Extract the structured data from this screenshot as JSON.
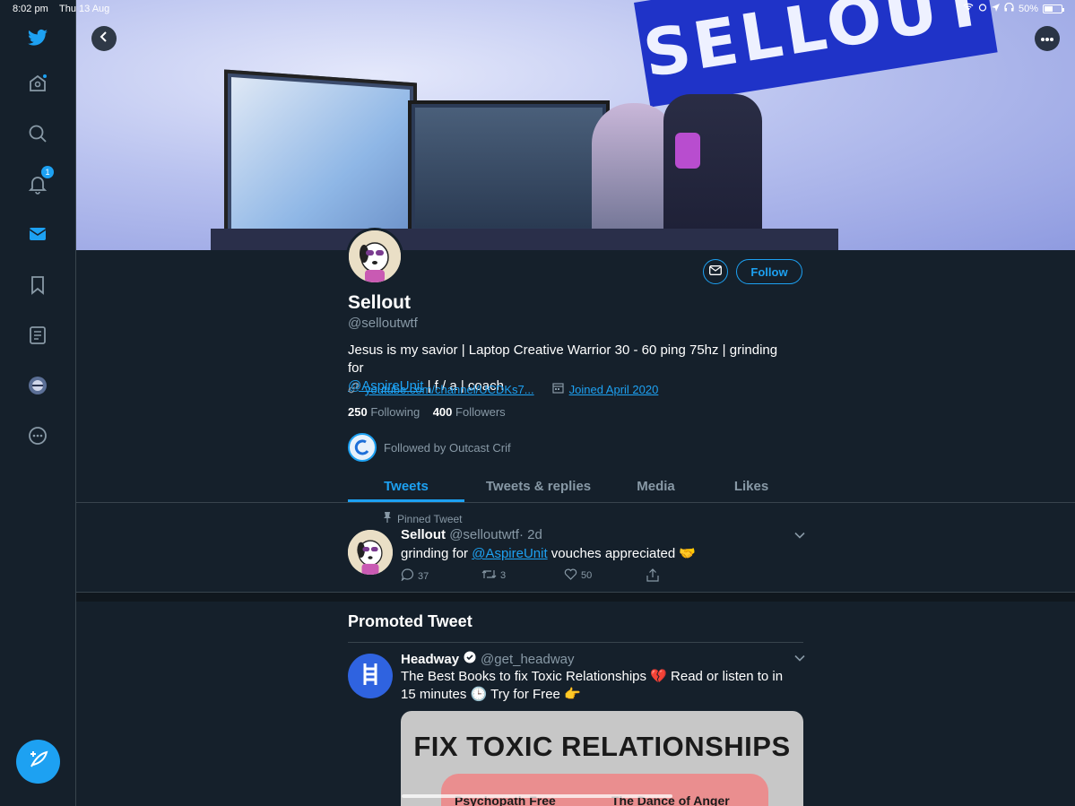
{
  "status_bar": {
    "time": "8:02 pm",
    "date": "Thu 13 Aug",
    "battery_text": "50%",
    "battery_level": 0.5
  },
  "sidebar": {
    "items": [
      {
        "icon": "twitter-bird-icon"
      },
      {
        "icon": "home-icon"
      },
      {
        "icon": "search-icon"
      },
      {
        "icon": "notifications-bell-icon",
        "badge": "1"
      },
      {
        "icon": "messages-mail-icon"
      },
      {
        "icon": "bookmark-icon"
      },
      {
        "icon": "lists-icon"
      },
      {
        "icon": "profile-avatar-icon"
      },
      {
        "icon": "more-icon"
      }
    ],
    "compose_icon": "compose-quill-icon"
  },
  "profile": {
    "display_name": "Sellout",
    "handle": "@selloutwtf",
    "bio_prefix": "Jesus is my savior | Laptop Creative Warrior 30 - 60 ping 75hz | grinding for",
    "bio_mention": "@AspireUnit",
    "bio_suffix": " | f / a | coach",
    "website": "youtube.com/channel/UCDKs7...",
    "joined": "Joined April 2020",
    "following_count": "250",
    "following_label": "Following",
    "followers_count": "400",
    "followers_label": "Followers",
    "followed_by": "Followed by Outcast Crif",
    "follow_button": "Follow",
    "banner_sign_text": "SELLOUT"
  },
  "tabs": [
    {
      "label": "Tweets",
      "active": true
    },
    {
      "label": "Tweets & replies",
      "active": false
    },
    {
      "label": "Media",
      "active": false
    },
    {
      "label": "Likes",
      "active": false
    }
  ],
  "pinned_tweet": {
    "label": "Pinned Tweet",
    "name": "Sellout",
    "handle": "@selloutwtf",
    "time": "· 2d",
    "text_prefix": "grinding for ",
    "mention": "@AspireUnit",
    "text_suffix": " vouches appreciated 🤝",
    "replies": "37",
    "retweets": "3",
    "likes": "50"
  },
  "promoted": {
    "section_title": "Promoted Tweet",
    "name": "Headway",
    "handle": "@get_headway",
    "text": "The Best Books to fix Toxic Relationships 💔  Read or listen to in 15 minutes 🕒  Try for Free 👉",
    "card_title": "FIX TOXIC RELATIONSHIPS",
    "card_book_1": "Psychopath Free",
    "card_book_2": "The Dance of Anger"
  },
  "colors": {
    "background": "#15202b",
    "accent": "#1da1f2",
    "muted": "#8899a6",
    "border": "#38444d"
  }
}
